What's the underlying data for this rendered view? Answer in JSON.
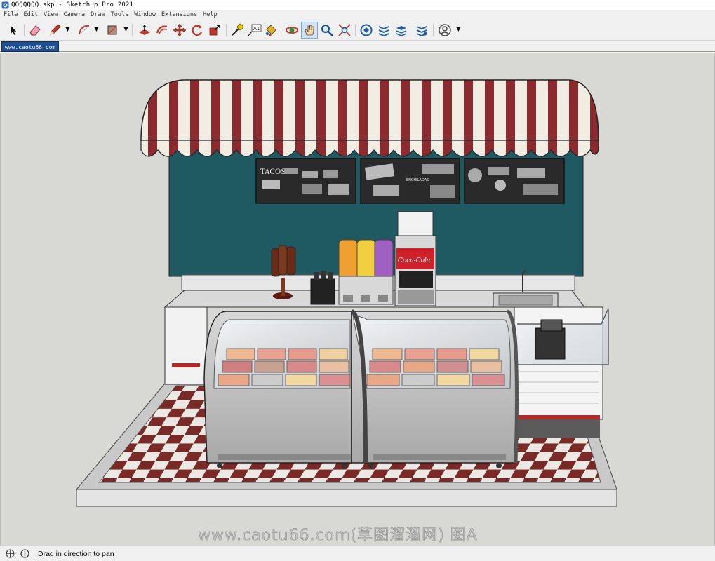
{
  "window": {
    "title": "QQQQQQQ.skp - SketchUp Pro 2021"
  },
  "menu": [
    "File",
    "Edit",
    "View",
    "Camera",
    "Draw",
    "Tools",
    "Window",
    "Extensions",
    "Help"
  ],
  "toolbar": {
    "tools": [
      {
        "name": "select-icon"
      },
      {
        "name": "eraser-icon"
      },
      {
        "name": "pencil-icon"
      },
      {
        "name": "arc-icon"
      },
      {
        "name": "rectangle-icon"
      },
      {
        "name": "push-pull-icon"
      },
      {
        "name": "offset-icon"
      },
      {
        "name": "move-icon"
      },
      {
        "name": "rotate-icon"
      },
      {
        "name": "scale-icon"
      },
      {
        "name": "tape-measure-icon"
      },
      {
        "name": "text-icon"
      },
      {
        "name": "paint-bucket-icon"
      },
      {
        "name": "orbit-icon"
      },
      {
        "name": "pan-icon",
        "active": true
      },
      {
        "name": "zoom-icon"
      },
      {
        "name": "zoom-extents-icon"
      },
      {
        "name": "3d-warehouse-icon"
      },
      {
        "name": "extension-warehouse-icon"
      },
      {
        "name": "layout-icon"
      },
      {
        "name": "extension-manager-icon"
      },
      {
        "name": "account-icon"
      }
    ],
    "text_tool_glyph": "A1"
  },
  "scene_tab": {
    "label": "www.caotu66.com"
  },
  "model": {
    "menu_board_title": "TACOS",
    "menu_board_sub": "ENCHILADAS",
    "dispenser_logo": "Coca-Cola"
  },
  "watermark": {
    "text": "www.caotu66.com(草图溜溜网) 图A"
  },
  "status": {
    "text": "Drag in direction to pan"
  },
  "colors": {
    "awning_red": "#8b2a2f",
    "wall_teal": "#1f5a63",
    "tile_red": "#7a2a26",
    "active_tool": "#cfe3f7"
  }
}
